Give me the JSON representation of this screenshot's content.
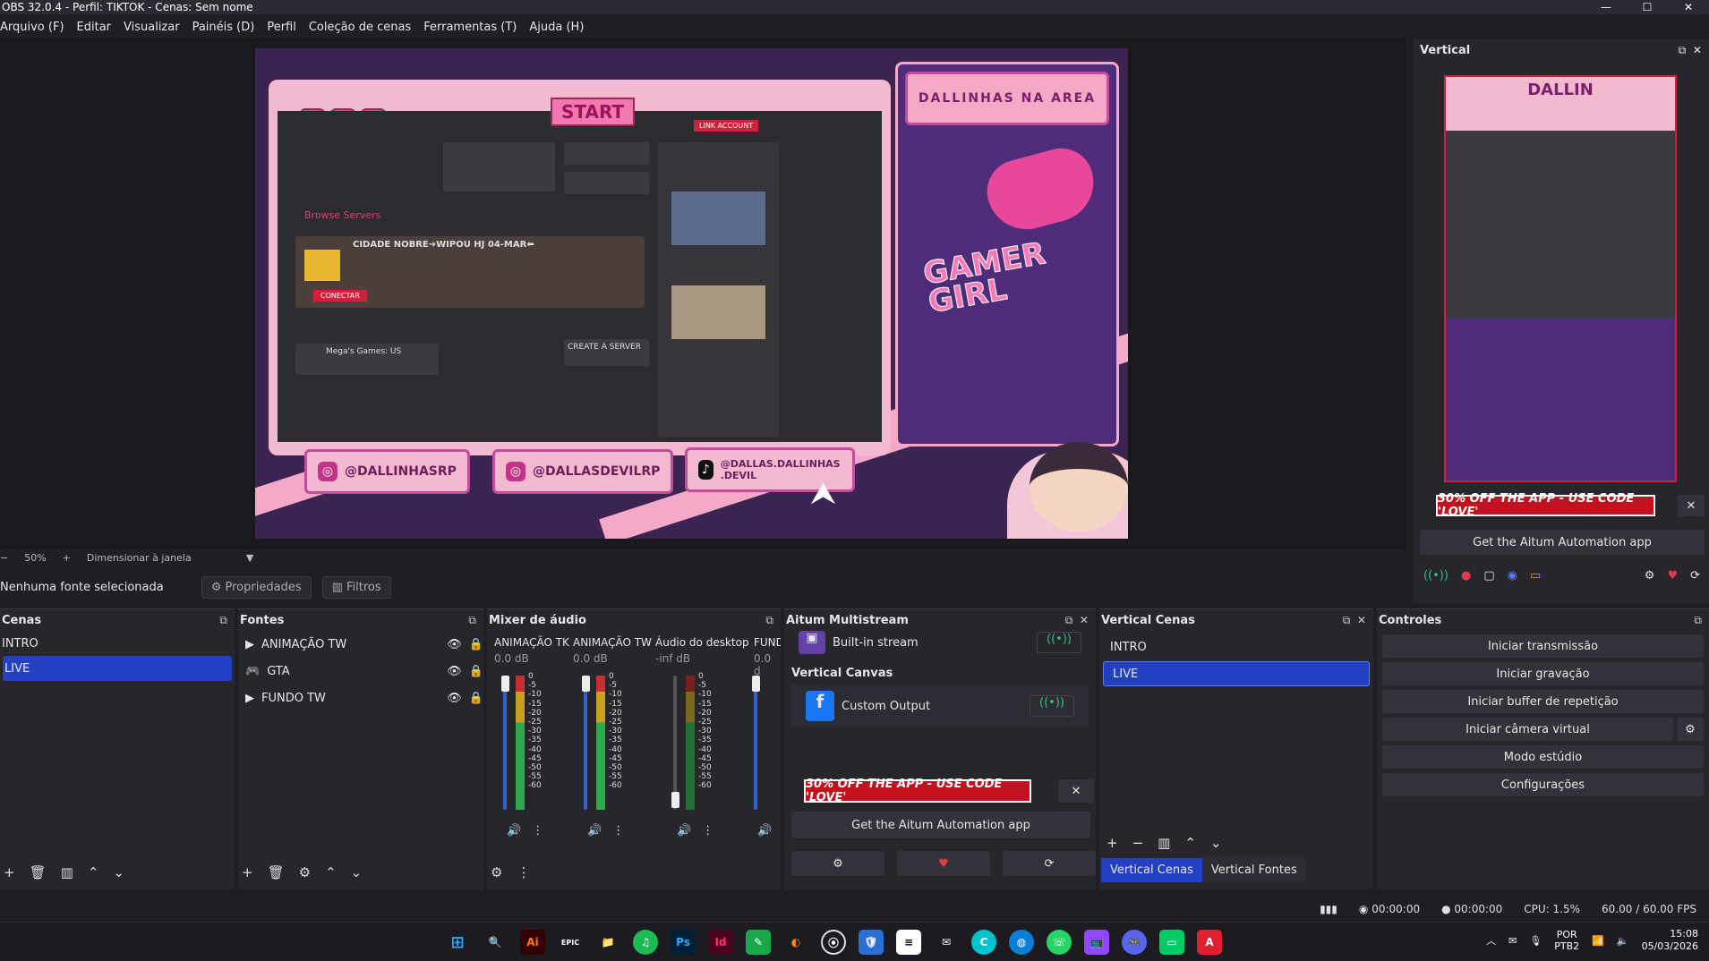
{
  "window": {
    "title": "OBS 32.0.4 - Perfil: TIKTOK - Cenas: Sem nome",
    "controls": [
      "—",
      "☐",
      "✕"
    ]
  },
  "menu": [
    "Arquivo (F)",
    "Editar",
    "Visualizar",
    "Painéis (D)",
    "Perfil",
    "Coleção de cenas",
    "Ferramentas (T)",
    "Ajuda (H)"
  ],
  "canvas": {
    "start": "START",
    "browse": "Browse Servers",
    "server_name": "CIDADE NOBRE➔WIPOU HJ 04-MAR⬅",
    "featured": "Mega's Games: US",
    "create": "CREATE A SERVER",
    "connect": "CONECTAR",
    "link": "LINK ACCOUNT",
    "socials": [
      "@DALLINHASRP",
      "@DALLASDEVILRP",
      "@DALLAS.DALLINHAS .DEVIL"
    ],
    "banner": "DALLINHAS NA AREA",
    "gamer": "GAMER GIRL"
  },
  "zoom": {
    "value": "50%",
    "mode": "Dimensionar à janela"
  },
  "source_bar": {
    "none": "Nenhuma fonte selecionada",
    "props": "Propriedades",
    "filters": "Filtros"
  },
  "scenes": {
    "title": "Cenas",
    "items": [
      "INTRO",
      "LIVE"
    ],
    "selected": "LIVE"
  },
  "sources": {
    "title": "Fontes",
    "items": [
      "ANIMAÇÃO TW",
      "GTA",
      "FUNDO TW"
    ]
  },
  "mixer": {
    "title": "Mixer de áudio",
    "channels": [
      {
        "name": "ANIMAÇÃO TK",
        "db": "0.0 dB"
      },
      {
        "name": "ANIMAÇÃO TW",
        "db": "0.0 dB"
      },
      {
        "name": "Áudio do desktop",
        "db": "-inf dB"
      },
      {
        "name": "FUND",
        "db": "0.0 d"
      }
    ],
    "scale": [
      "0",
      "-5",
      "-10",
      "-15",
      "-20",
      "-25",
      "-30",
      "-35",
      "-40",
      "-45",
      "-50",
      "-55",
      "-60"
    ]
  },
  "multistream": {
    "title": "Aitum Multistream",
    "builtin": "Built-in stream",
    "vertical": "Vertical Canvas",
    "custom": "Custom Output",
    "promo": "30% OFF THE APP - USE CODE 'LOVE'",
    "get_app": "Get the Aitum Automation app"
  },
  "vscenes": {
    "title": "Vertical Cenas",
    "items": [
      "INTRO",
      "LIVE"
    ],
    "selected": "LIVE",
    "tabs": [
      "Vertical Cenas",
      "Vertical Fontes"
    ]
  },
  "controls": {
    "title": "Controles",
    "items": [
      "Iniciar transmissão",
      "Iniciar gravação",
      "Iniciar buffer de repetição",
      "Iniciar câmera virtual",
      "Modo estúdio",
      "Configurações"
    ]
  },
  "vertical": {
    "title": "Vertical",
    "promo": "30% OFF THE APP - USE CODE 'LOVE'",
    "get_app": "Get the Aitum Automation app",
    "label": "DALLIN"
  },
  "status": {
    "stream_time": "00:00:00",
    "rec_time": "00:00:00",
    "cpu": "CPU: 1.5%",
    "fps": "60.00 / 60.00 FPS"
  },
  "tray": {
    "lang": "POR",
    "lang2": "PTB2",
    "time": "15:08",
    "date": "05/03/2026"
  },
  "taskbar": [
    "⊞",
    "🔍",
    "Ai",
    "EPIC",
    "📁",
    "♫",
    "Ps",
    "Id",
    "✎",
    "◐",
    "⦿",
    "🛡",
    "≡",
    "✉",
    "C",
    "◍",
    "☏",
    "📺",
    "🎮",
    "▭",
    "A"
  ]
}
